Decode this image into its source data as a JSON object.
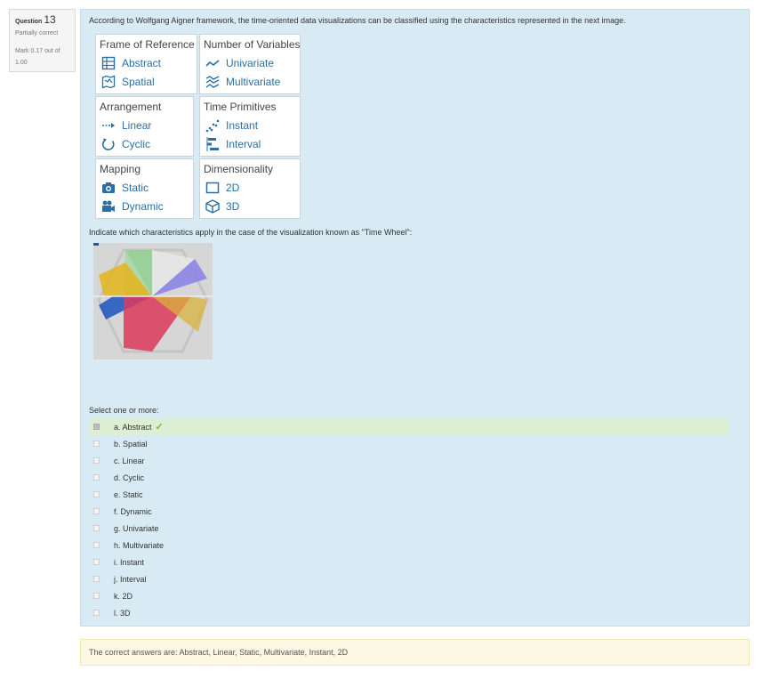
{
  "info": {
    "question_word": "Question",
    "number": "13",
    "state": "Partially correct",
    "grade": "Mark 0.17 out of 1.00"
  },
  "question": {
    "text": "According to Wolfgang Aigner framework, the time-oriented data visualizations can be classified using the characteristics represented in the next image.",
    "prompt": "Indicate which characteristics apply in the case of the visualization known as \"Time Wheel\":",
    "select_label": "Select one or more:"
  },
  "categories": [
    {
      "title": "Frame of Reference",
      "items": [
        {
          "label": "Abstract",
          "icon": "grid-icon"
        },
        {
          "label": "Spatial",
          "icon": "map-icon"
        }
      ]
    },
    {
      "title": "Number of Variables",
      "items": [
        {
          "label": "Univariate",
          "icon": "line-icon"
        },
        {
          "label": "Multivariate",
          "icon": "multiline-icon"
        }
      ]
    },
    {
      "title": "Arrangement",
      "items": [
        {
          "label": "Linear",
          "icon": "arrow-right-icon"
        },
        {
          "label": "Cyclic",
          "icon": "cycle-icon"
        }
      ]
    },
    {
      "title": "Time Primitives",
      "items": [
        {
          "label": "Instant",
          "icon": "dots-icon"
        },
        {
          "label": "Interval",
          "icon": "bars-icon"
        }
      ]
    },
    {
      "title": "Mapping",
      "items": [
        {
          "label": "Static",
          "icon": "camera-icon"
        },
        {
          "label": "Dynamic",
          "icon": "video-camera-icon"
        }
      ]
    },
    {
      "title": "Dimensionality",
      "items": [
        {
          "label": "2D",
          "icon": "square-icon"
        },
        {
          "label": "3D",
          "icon": "cube-icon"
        }
      ]
    }
  ],
  "answers": [
    {
      "label": "a. Abstract",
      "checked": true,
      "correct": true
    },
    {
      "label": "b. Spatial",
      "checked": false
    },
    {
      "label": "c. Linear",
      "checked": false
    },
    {
      "label": "d. Cyclic",
      "checked": false
    },
    {
      "label": "e. Static",
      "checked": false
    },
    {
      "label": "f. Dynamic",
      "checked": false
    },
    {
      "label": "g. Univariate",
      "checked": false
    },
    {
      "label": "h. Multivariate",
      "checked": false
    },
    {
      "label": "i. Instant",
      "checked": false
    },
    {
      "label": "j. Interval",
      "checked": false
    },
    {
      "label": "k. 2D",
      "checked": false
    },
    {
      "label": "l. 3D",
      "checked": false
    }
  ],
  "feedback": {
    "text": "The correct answers are: Abstract, Linear, Static, Multivariate, Instant, 2D"
  },
  "colors": {
    "accent": "#2a6fa5",
    "correct": "#dcefd2",
    "check": "#7cb342"
  }
}
